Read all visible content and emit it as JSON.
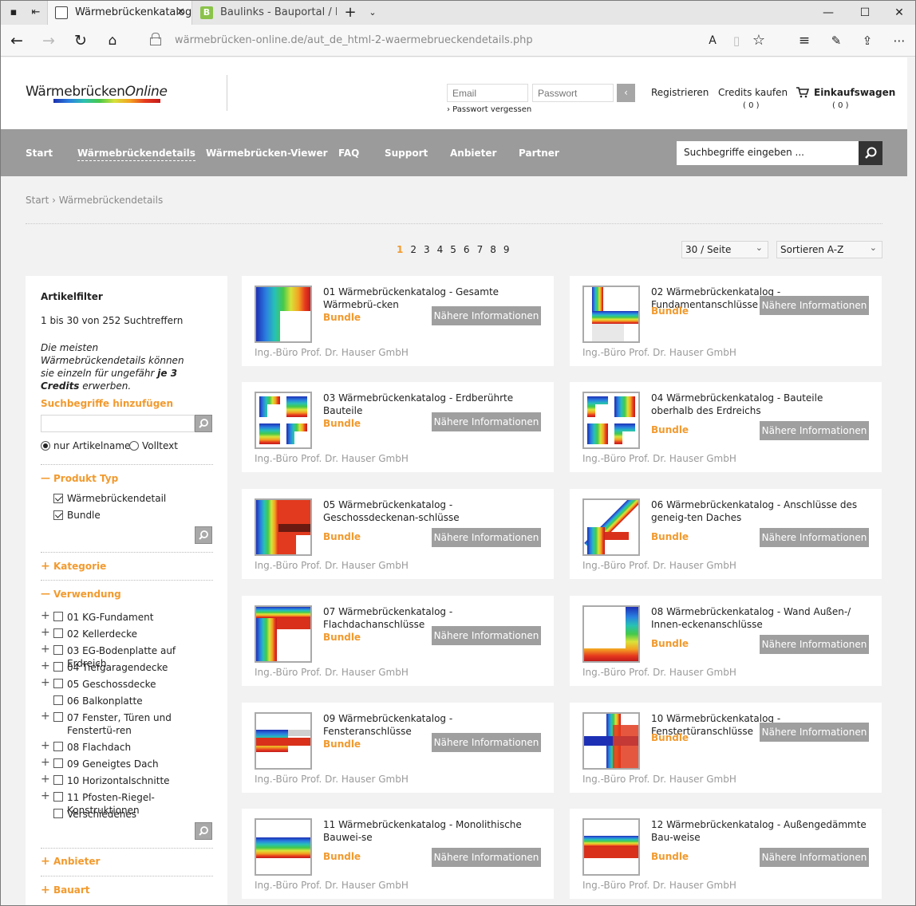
{
  "browser": {
    "tabs": [
      {
        "title": "Wärmebrückenkatalog,",
        "active": true
      },
      {
        "title": "Baulinks - Bauportal / Baum",
        "active": false
      }
    ],
    "url": "wärmebrücken-online.de/aut_de_html-2-waermebrueckendetails.php"
  },
  "header": {
    "logo_main": "WärmebrückenOnline",
    "email_placeholder": "Email",
    "password_placeholder": "Passwort",
    "forgot_password": "› Passwort vergessen",
    "register": "Registrieren",
    "buy_credits": "Credits kaufen",
    "credits_count": "( 0 )",
    "cart": "Einkaufswagen",
    "cart_count": "( 0 )"
  },
  "nav": {
    "items": [
      "Start",
      "Wärmebrückendetails",
      "Wärmebrücken-Viewer",
      "FAQ",
      "Support",
      "Anbieter",
      "Partner"
    ],
    "active": "Wärmebrückendetails",
    "search_placeholder": "Suchbegriffe eingeben ..."
  },
  "breadcrumb": "Start › Wärmebrückendetails",
  "pager": {
    "pages": [
      "1",
      "2",
      "3",
      "4",
      "5",
      "6",
      "7",
      "8",
      "9"
    ],
    "current": "1"
  },
  "per_page": "30 / Seite",
  "sort": "Sortieren A-Z",
  "sidebar": {
    "title": "Artikelfilter",
    "hits": "1 bis 30 von 252 Suchtreffern",
    "note_part1": "Die meisten Wärmebrückendetails können sie einzeln für ungefähr ",
    "note_bold": "je 3 Credits",
    "note_part2": " erwerben.",
    "add_terms": "Suchbegriffe hinzufügen",
    "radio_name": "nur Artikelname",
    "radio_full": "Volltext",
    "produkt_typ": "Produkt Typ",
    "produkt_items": [
      "Wärmebrückendetail",
      "Bundle"
    ],
    "kategorie": "Kategorie",
    "verwendung": "Verwendung",
    "verwendung_items": [
      {
        "label": "01 KG-Fundament",
        "plus": true
      },
      {
        "label": "02 Kellerdecke",
        "plus": true
      },
      {
        "label": "03 EG-Bodenplatte auf Erdreich",
        "plus": true
      },
      {
        "label": "04 Tiefgaragendecke",
        "plus": true
      },
      {
        "label": "05 Geschossdecke",
        "plus": true
      },
      {
        "label": "06 Balkonplatte",
        "plus": false
      },
      {
        "label": "07 Fenster, Türen und Fenstertü-ren",
        "plus": true
      },
      {
        "label": "08 Flachdach",
        "plus": true
      },
      {
        "label": "09 Geneigtes Dach",
        "plus": true
      },
      {
        "label": "10 Horizontalschnitte",
        "plus": true
      },
      {
        "label": "11 Pfosten-Riegel-Konstruktionen",
        "plus": true
      },
      {
        "label": "Verschiedenes",
        "plus": false
      }
    ],
    "anbieter": "Anbieter",
    "bauart": "Bauart"
  },
  "cards": [
    {
      "title": "01 Wärmebrückenkatalog - Gesamte Wärmebrü-cken",
      "badge": "Bundle",
      "button": "Nähere Informationen",
      "vendor": "Ing.-Büro Prof. Dr. Hauser GmbH"
    },
    {
      "title": "02 Wärmebrückenkatalog - Fundamentanschlüsse",
      "badge": "Bundle",
      "button": "Nähere Informationen",
      "vendor": "Ing.-Büro Prof. Dr. Hauser GmbH"
    },
    {
      "title": "03 Wärmebrückenkatalog - Erdberührte Bauteile",
      "badge": "Bundle",
      "button": "Nähere Informationen",
      "vendor": "Ing.-Büro Prof. Dr. Hauser GmbH"
    },
    {
      "title": "04 Wärmebrückenkatalog - Bauteile oberhalb des Erdreichs",
      "badge": "Bundle",
      "button": "Nähere Informationen",
      "vendor": "Ing.-Büro Prof. Dr. Hauser GmbH"
    },
    {
      "title": "05 Wärmebrückenkatalog - Geschossdeckenan-schlüsse",
      "badge": "Bundle",
      "button": "Nähere Informationen",
      "vendor": "Ing.-Büro Prof. Dr. Hauser GmbH"
    },
    {
      "title": "06 Wärmebrückenkatalog - Anschlüsse des geneig-ten Daches",
      "badge": "Bundle",
      "button": "Nähere Informationen",
      "vendor": "Ing.-Büro Prof. Dr. Hauser GmbH"
    },
    {
      "title": "07 Wärmebrückenkatalog - Flachdachanschlüsse",
      "badge": "Bundle",
      "button": "Nähere Informationen",
      "vendor": "Ing.-Büro Prof. Dr. Hauser GmbH"
    },
    {
      "title": "08 Wärmebrückenkatalog - Wand Außen-/ Innen-eckenanschlüsse",
      "badge": "Bundle",
      "button": "Nähere Informationen",
      "vendor": "Ing.-Büro Prof. Dr. Hauser GmbH"
    },
    {
      "title": "09 Wärmebrückenkatalog - Fensteranschlüsse",
      "badge": "Bundle",
      "button": "Nähere Informationen",
      "vendor": "Ing.-Büro Prof. Dr. Hauser GmbH"
    },
    {
      "title": "10 Wärmebrückenkatalog - Fenstertüranschlüsse",
      "badge": "Bundle",
      "button": "Nähere Informationen",
      "vendor": "Ing.-Büro Prof. Dr. Hauser GmbH"
    },
    {
      "title": "11 Wärmebrückenkatalog - Monolithische Bauwei-se",
      "badge": "Bundle",
      "button": "Nähere Informationen",
      "vendor": "Ing.-Büro Prof. Dr. Hauser GmbH"
    },
    {
      "title": "12 Wärmebrückenkatalog - Außengedämmte Bau-weise",
      "badge": "Bundle",
      "button": "Nähere Informationen",
      "vendor": "Ing.-Büro Prof. Dr. Hauser GmbH"
    }
  ],
  "colors": {
    "accent": "#f29a2e",
    "nav": "#9b9b9b",
    "button": "#9f9f9f"
  }
}
